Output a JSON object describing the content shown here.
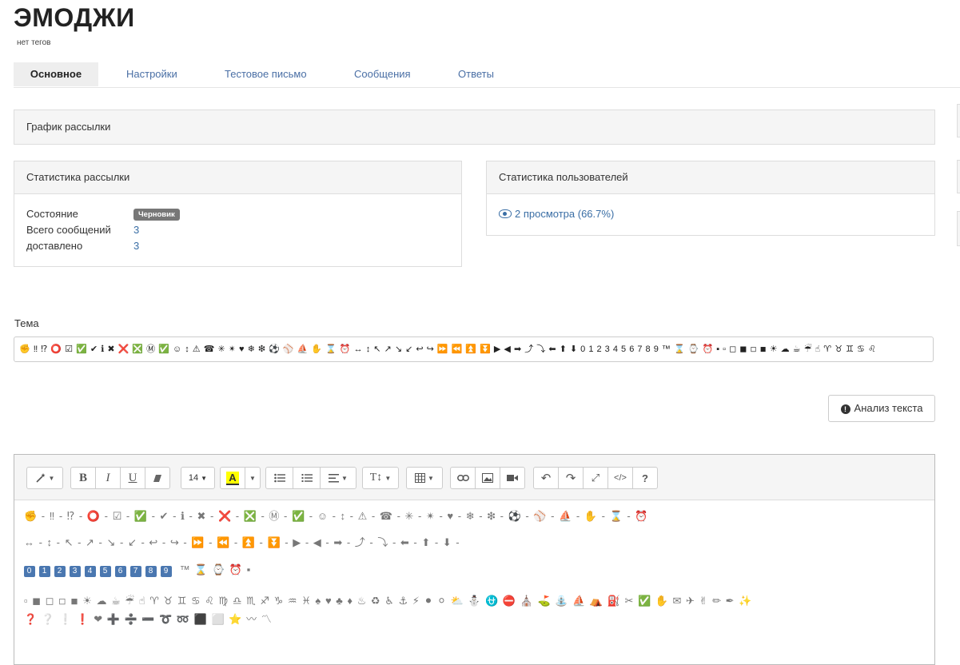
{
  "page": {
    "title": "ЭМОДЖИ",
    "tags": "нет тегов"
  },
  "tabs": [
    {
      "label": "Основное",
      "active": true
    },
    {
      "label": "Настройки"
    },
    {
      "label": "Тестовое письмо"
    },
    {
      "label": "Сообщения"
    },
    {
      "label": "Ответы"
    }
  ],
  "schedule": {
    "title": "График рассылки"
  },
  "send_stats": {
    "title": "Статистика рассылки",
    "state_label": "Состояние",
    "state_value": "Черновик",
    "total_label": "Всего сообщений",
    "total_value": "3",
    "delivered_label": "доставлено",
    "delivered_value": "3"
  },
  "user_stats": {
    "title": "Статистика пользователей",
    "views": "2 просмотра (66.7%)"
  },
  "subject": {
    "label": "Тема",
    "value": "✊ ‼ ⁉ ⭕ ☑ ✅ ✔ ℹ ✖ ❌ ❎ Ⓜ ✅ ☺ ↕ ⚠ ☎ ✳ ✴ ♥ ❄ ❇ ⚽ ⚾ ⛵ ✋ ⌛ ⏰ ↔ ↕ ↖ ↗ ↘ ↙ ↩ ↪ ⏩ ⏪ ⏫ ⏬ ▶ ◀ ➡ ⤴ ⤵ ⬅ ⬆ ⬇ 0 1 2 3 4 5 6 7 8 9 ™ ⌛ ⌚ ⏰ ▪ ▫ ◻ ◼ ◽ ◾ ☀ ☁ ☕ ☔ ☝ ♈ ♉ ♊ ♋ ♌"
  },
  "analyze_button": "Анализ текста",
  "toolbar": {
    "font_size": "14"
  },
  "editor": {
    "line1": "✊ - ‼ - ⁉ - ⭕ - ☑ - ✅ - ✔ - ℹ - ✖ - ❌ - ❎ - Ⓜ - ✅ - ☺ - ↕ - ⚠ - ☎ - ✳ - ✴ - ♥ - ❄ - ❇ - ⚽ - ⚾ - ⛵ - ✋ - ⌛ - ⏰",
    "line2": "↔ - ↕ - ↖ - ↗ - ↘ - ↙ - ↩ - ↪ - ⏩ - ⏪ - ⏫ - ⏬ - ▶ - ◀ - ➡ - ⤴ - ⤵ - ⬅ - ⬆ - ⬇ -",
    "digits": [
      "0",
      "1",
      "2",
      "3",
      "4",
      "5",
      "6",
      "7",
      "8",
      "9"
    ],
    "line3_tail": "™  ⌛ ⌚ ⏰ ▪",
    "line4": "▫ ◼ ◻ ◽ ◾ ☀ ☁ ☕ ☔ ☝ ♈ ♉ ♊ ♋ ♌ ♍ ♎ ♏ ♐ ♑ ♒ ♓ ♠ ♥ ♣ ♦ ♨ ♻ ♿ ⚓ ⚡ ⚫ ⚪ ⛅ ⛄ ⛎ ⛔ ⛪ ⛳ ⛲ ⛵ ⛺ ⛽ ✂ ✅ ✋ ✉ ✈ ✌ ✏ ✒ ✨",
    "line5": "❓ ❔ ❕ ❗ ❤ ➕ ➗ ➖ ➰ ➿ ⬛ ⬜ ⭐ 〰 〽"
  }
}
